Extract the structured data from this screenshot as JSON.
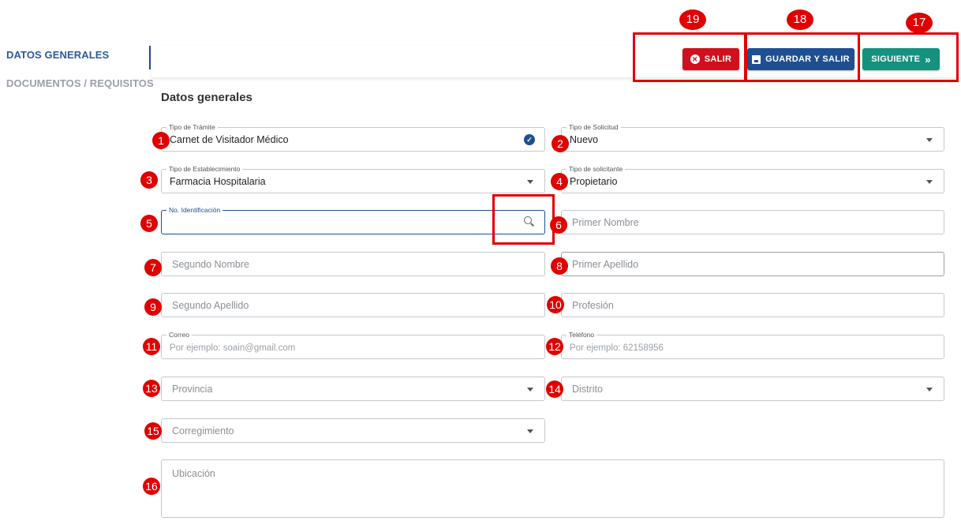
{
  "sidebar": {
    "items": [
      {
        "label": "DATOS GENERALES"
      },
      {
        "label": "DOCUMENTOS / REQUISITOS"
      }
    ]
  },
  "actions": {
    "salir": "SALIR",
    "guardar": "GUARDAR Y SALIR",
    "siguiente": "SIGUIENTE",
    "siguiente_icon": "»"
  },
  "section_title": "Datos generales",
  "annotations": {
    "n1": "1",
    "n2": "2",
    "n3": "3",
    "n4": "4",
    "n5": "5",
    "n6": "6",
    "n7": "7",
    "n8": "8",
    "n9": "9",
    "n10": "10",
    "n11": "11",
    "n12": "12",
    "n13": "13",
    "n14": "14",
    "n15": "15",
    "n16": "16",
    "n17": "17",
    "n18": "18",
    "n19": "19"
  },
  "form": {
    "tipo_tramite": {
      "label": "Tipo de Trámite",
      "value": "Carnet de Visitador Médico"
    },
    "tipo_solicitud": {
      "label": "Tipo de Solicitud",
      "value": "Nuevo"
    },
    "tipo_establecimiento": {
      "label": "Tipo de Establecimiento",
      "value": "Farmacia Hospitalaria"
    },
    "tipo_solicitante": {
      "label": "Tipo de solicitante",
      "value": "Propietario"
    },
    "identificacion": {
      "label": "No. Identificación",
      "value": ""
    },
    "primer_nombre": {
      "placeholder": "Primer Nombre"
    },
    "segundo_nombre": {
      "placeholder": "Segundo Nombre"
    },
    "primer_apellido": {
      "placeholder": "Primer Apellido"
    },
    "segundo_apellido": {
      "placeholder": "Segundo Apellido"
    },
    "profesion": {
      "placeholder": "Profesión"
    },
    "correo": {
      "label": "Correo",
      "placeholder": "Por ejemplo: soain@gmail.com"
    },
    "telefono": {
      "label": "Teléfono",
      "placeholder": "Por ejemplo: 62158956"
    },
    "provincia": {
      "placeholder": "Provincia"
    },
    "distrito": {
      "placeholder": "Distrito"
    },
    "corregimiento": {
      "placeholder": "Corregimiento"
    },
    "ubicacion": {
      "placeholder": "Ubicación"
    }
  },
  "colors": {
    "primary": "#1e4f92",
    "danger": "#d0101d",
    "success": "#14917f",
    "annotation": "#e00000"
  }
}
